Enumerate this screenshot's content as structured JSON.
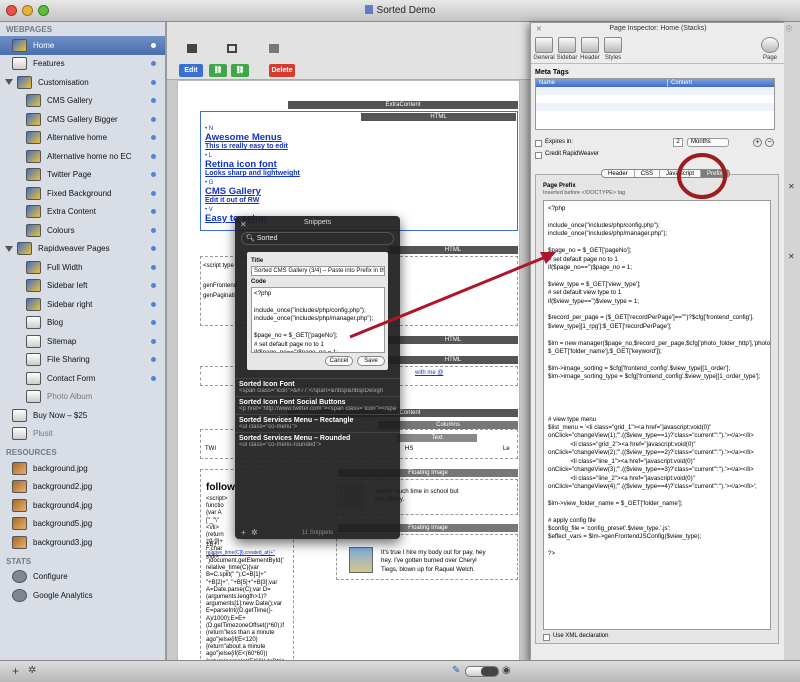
{
  "window": {
    "title": "Sorted Demo"
  },
  "sidebar": {
    "webpages_header": "WEBPAGES",
    "pages": [
      {
        "label": "Home",
        "selected": true,
        "icon": "home",
        "level": 0
      },
      {
        "label": "Features",
        "icon": "page",
        "level": 0
      },
      {
        "label": "Customisation",
        "icon": "stack",
        "level": 0,
        "folder": true
      },
      {
        "label": "CMS Gallery",
        "icon": "stack",
        "level": 1
      },
      {
        "label": "CMS Gallery Bigger",
        "icon": "stack",
        "level": 1
      },
      {
        "label": "Alternative home",
        "icon": "stack",
        "level": 1
      },
      {
        "label": "Alternative home no EC",
        "icon": "stack",
        "level": 1
      },
      {
        "label": "Twitter Page",
        "icon": "stack",
        "level": 1
      },
      {
        "label": "Fixed Background",
        "icon": "stack",
        "level": 1
      },
      {
        "label": "Extra Content",
        "icon": "stack",
        "level": 1
      },
      {
        "label": "Colours",
        "icon": "stack",
        "level": 1
      },
      {
        "label": "Rapidweaver Pages",
        "icon": "stack",
        "level": 0,
        "folder": true
      },
      {
        "label": "Full Width",
        "icon": "stack",
        "level": 1
      },
      {
        "label": "Sidebar left",
        "icon": "stack",
        "level": 1
      },
      {
        "label": "Sidebar right",
        "icon": "stack",
        "level": 1
      },
      {
        "label": "Blog",
        "icon": "page",
        "level": 1
      },
      {
        "label": "Sitemap",
        "icon": "page",
        "level": 1
      },
      {
        "label": "File Sharing",
        "icon": "page",
        "level": 1
      },
      {
        "label": "Contact Form",
        "icon": "page",
        "level": 1
      },
      {
        "label": "Photo Album",
        "icon": "page",
        "level": 1,
        "dim": true
      },
      {
        "label": "Buy Now – $25",
        "icon": "page",
        "level": 0
      },
      {
        "label": "Plusit",
        "icon": "page",
        "level": 0,
        "dim": true
      }
    ],
    "resources_header": "RESOURCES",
    "resources": [
      "background.jpg",
      "background2.jpg",
      "background4.jpg",
      "background5.jpg",
      "background3.jpg"
    ],
    "stats_header": "STATS",
    "stats": [
      "Configure",
      "Google Analytics"
    ]
  },
  "toolbar": {
    "edit_label": "Edit",
    "delete_label": "Delete"
  },
  "editor": {
    "extra_content_label": "ExtraContent",
    "html_label": "HTML",
    "html2_label": "HTML",
    "html3_label": "HTML",
    "html4_label": "HTML",
    "extra_content2_label": "ExtraContent",
    "columns_label": "Columns",
    "text_label": "Text",
    "floating_image_label": "Floating Image",
    "floating_image2_label": "Floating Image",
    "menu": [
      {
        "key": "N",
        "title": "Awesome Menus",
        "sub": "This is really easy to edit"
      },
      {
        "key": "L",
        "title": "Retina icon font",
        "sub": "Looks sharp and lightweight"
      },
      {
        "key": "G",
        "title": "CMS Gallery",
        "sub": "Edit it out of RW"
      },
      {
        "key": "V",
        "title": "Easy to setup",
        "sub": ""
      }
    ],
    "script_type": "<script type",
    "gen_frontend": "genFrontend",
    "gen_paginat": "genPaginati",
    "twi": "TWI",
    "hs": "HS",
    "le": "Le",
    "with_me": "with me  @",
    "follow": "follow",
    "script_lines": [
      "<script>",
      "functio",
      "{var A",
      "[\"_\"\\\"",
      "<\\/li>",
      "(return",
      "z0-9]+",
      "F.char",
      "<\\/li>"
    ],
    "relative_time": "+B+",
    "created_link": "relative_time(C[i].created_at)+\"",
    "js_lines": [
      "\")document.getElementById('",
      "relative_time(C){var",
      "B=C.split(\" \");C=B[1]+\"",
      "\"+B[2]+\", \"+B[5]+\"+B[3];var",
      "A=Date.parse(C);var D=",
      "(arguments.length>1)?",
      "arguments[1]:new Date();var",
      "E=parseInt((D.getTime()-",
      "A)/1000);E=E+",
      "(D.getTimezoneOffset()*60);if",
      "(return\"less than a minute",
      "ago\"}else{if(E<120)",
      "{return\"about a minute",
      "ago\"}else{if(E<(60*60))",
      "{return(parseInt(E/60)).toStrin"
    ],
    "float_text1": "spend much time in school but\nlots plenty.",
    "float_text2": "It's true I hire my body out for pay, hey\nhey. I've gotten burned over Cheryl\nTiegs, blown up for Raquel Welch."
  },
  "snippets": {
    "title": "Snippets",
    "search_value": "Sorted",
    "form_title_label": "Title",
    "form_title_value": "Sorted CMS Gallery (3/4) – Paste into Prefix in the Pa",
    "form_code_label": "Code",
    "form_code_value": "<?php\n\ninclude_once(\"includes/php/config.php\");\ninclude_once(\"includes/php/manager.php\");\n\n$page_no = $_GET['pageNo'];\n# set default page no to 1\nif($page_no=='')$page_no = 1;",
    "cancel_label": "Cancel",
    "save_label": "Save",
    "items": [
      {
        "title": "Sorted Icon Font",
        "code": "<span class=\"icon\">&#77;</span>&nbsp&nbspDesign"
      },
      {
        "title": "Sorted Icon Font Social Buttons",
        "code": "<p href=\"http://www.twitter.com\"><span class=\"icon\"></span>"
      },
      {
        "title": "Sorted Services Menu – Rectangle",
        "code": "<ul class=\"co-menu\">"
      },
      {
        "title": "Sorted Services Menu – Rounded",
        "code": "<ul class=\"co-menu-rounded\">"
      }
    ],
    "count": "11 Snippets"
  },
  "inspector": {
    "title": "Page Inspector: Home (Stacks)",
    "tabs": [
      "General",
      "Sidebar",
      "Header",
      "Styles"
    ],
    "page_tab": "Page",
    "meta_tags_label": "Meta Tags",
    "col_name": "Name",
    "col_content": "Content",
    "expires_label": "Expires in:",
    "expires_value": "2",
    "expires_unit": "Months",
    "credit_label": "Credit RapidWeaver",
    "subtabs": [
      "Header",
      "CSS",
      "JavaScript",
      "Prefix"
    ],
    "active_subtab": "Prefix",
    "page_prefix_label": "Page Prefix",
    "inserted_before": "Inserted before <!DOCTYPE> tag",
    "code": "<?php\n\ninclude_once(\"includes/php/config.php\");\ninclude_once(\"includes/php/manager.php\");\n\n$page_no = $_GET['pageNo'];\n# set default page no to 1\nif($page_no=='')$page_no = 1;\n\n$view_type = $_GET['view_type'];\n# set default view type to 1\nif($view_type=='')$view_type = 1;\n\n$record_per_page = ($_GET['recordPerPage']==\"\")?$cfg['frontend_config'].\n$view_type][1_rpg']:$_GET['recordPerPage'];\n\n$lm = new manager($page_no,$record_per_page,$cfg['photo_folder_http'],'photo',\n$_GET['folder_name'],$_GET['keyword']);\n\n$lm->image_sorting = $cfg['frontend_config'.$view_type][1_order'];\n$lm->image_sorting_type = $cfg['frontend_config'.$view_type][1_order_type'];\n\n\n\n\n# view type menu\n$list_menu = '<li class=\"grid_1\"><a href=\"javascript:void(0)\"\nonClick=\"changeView(1);\"'.(($view_type==1)?'class=\"current\"':'').'></a></li>\n             <li class=\"grid_2\"><a href=\"javascript:void(0)\"\nonClick=\"changeView(2);\"'.(($view_type==2)?'class=\"current\"':'').'></a></li>\n             <li class=\"line_1\"><a href=\"javascript:void(0)\"\nonClick=\"changeView(3);\"'.(($view_type==3)?'class=\"current\"':'').'></a></li>\n             <li class=\"line_2\"><a href=\"javascript:void(0)\"\nonClick=\"changeView(4);\"'.(($view_type==4)?'class=\"current\"':'').'></a></li>';\n\n$lm->view_folder_name = $_GET['folder_name'];\n\n# apply config file\n$config_file = 'config_preset'.$view_type.'.js';\n$effect_vars = $lm->genFrontendJSConfig($view_type);\n\n?>",
    "xml_label": "Use XML declaration"
  },
  "colors": {
    "accent": "#4a6fae",
    "highlight_ring": "#9e1c1c",
    "arrow": "#b0142a"
  }
}
